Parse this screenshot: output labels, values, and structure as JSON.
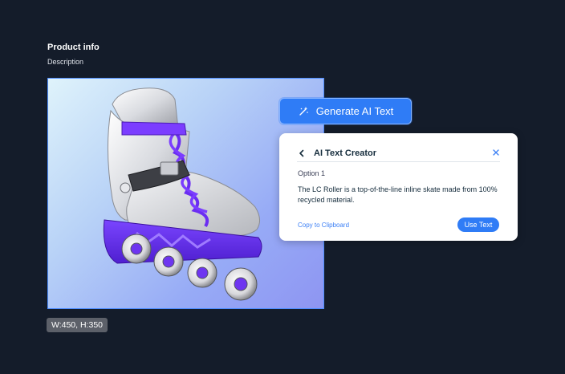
{
  "section": {
    "title": "Product info",
    "subtitle": "Description"
  },
  "image": {
    "dimensions": "W:450, H:350",
    "frame_color": "#4d8dff"
  },
  "generate_button": {
    "label": "Generate AI Text",
    "icon": "magic-wand-icon",
    "color": "#2f7cf6"
  },
  "panel": {
    "back_icon": "chevron-left-icon",
    "title": "AI Text Creator",
    "close_icon": "close-icon",
    "option_label": "Option 1",
    "option_text": "The LC Roller is a top-of-the-line inline skate made from 100% recycled material.",
    "copy_label": "Copy to Clipboard",
    "use_label": "Use Text"
  },
  "colors": {
    "background": "#141c2a",
    "accent": "#2f7cf6",
    "link": "#3b7ff5"
  }
}
